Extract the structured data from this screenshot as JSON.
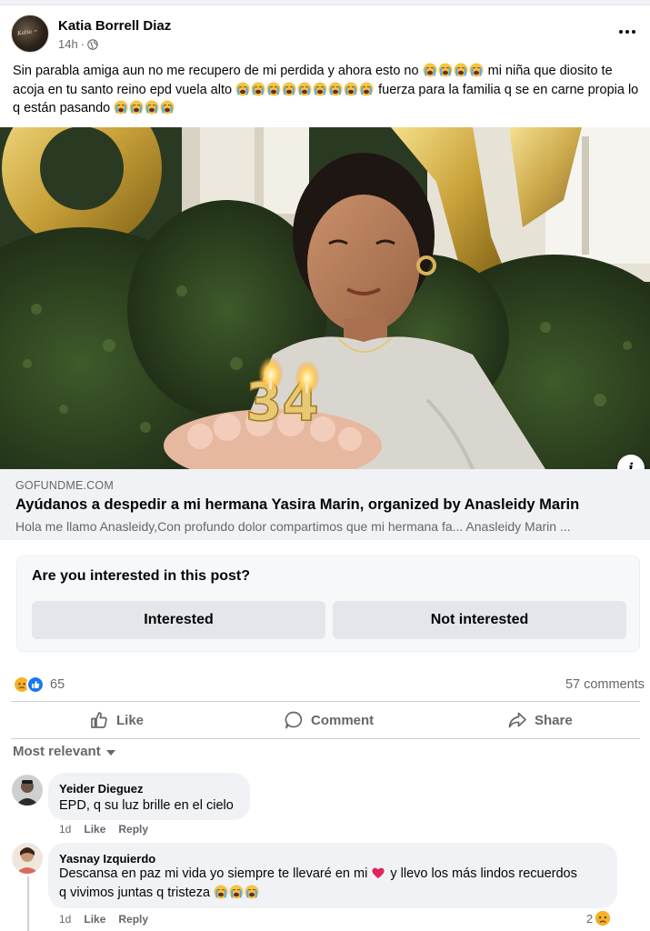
{
  "post": {
    "author": "Katia Borrell Diaz",
    "time": "14h",
    "separator": "·",
    "text_parts": [
      "Sin parabla amiga aun no me recupero de mi perdida y ahora esto no ",
      " mi niña que diosito te acoja en tu santo reino epd vuela alto ",
      " fuerza para la familia q se en carne propia lo q están pasando "
    ],
    "emoji": "crying-face"
  },
  "link": {
    "domain": "GOFUNDME.COM",
    "title": "Ayúdanos a despedir a mi hermana Yasira Marin, organized by Anasleidy Marin",
    "description": "Hola me llamo Anasleidy,Con profundo dolor compartimos que mi hermana fa... Anasleidy Marin ..."
  },
  "survey": {
    "question": "Are you interested in this post?",
    "interested": "Interested",
    "not_interested": "Not interested"
  },
  "stats": {
    "reaction_count": "65",
    "comments": "57 comments",
    "reaction_types": [
      "sad",
      "like"
    ]
  },
  "actions": {
    "like": "Like",
    "comment": "Comment",
    "share": "Share"
  },
  "sort": {
    "label": "Most relevant"
  },
  "comments": [
    {
      "author": "Yeider Dieguez",
      "text": "EPD, q su luz brille en el cielo",
      "time": "1d",
      "like": "Like",
      "reply": "Reply"
    },
    {
      "author": "Yasnay Izquierdo",
      "text_line1_a": "Descansa en paz mi vida yo siempre te llevaré en mi ",
      "text_line1_b": " y llevo los más lindos recuerdos",
      "text_line2": "q vivimos juntas q tristeza ",
      "time": "1d",
      "like": "Like",
      "reply": "Reply",
      "reaction_count": "2"
    }
  ],
  "colors": {
    "text": "#050505",
    "secondary": "#65676b",
    "surface": "#f0f2f5",
    "like_blue": "#1877f2",
    "sad_yellow": "#f7b125"
  },
  "photo": {
    "candle_numbers": "34"
  }
}
